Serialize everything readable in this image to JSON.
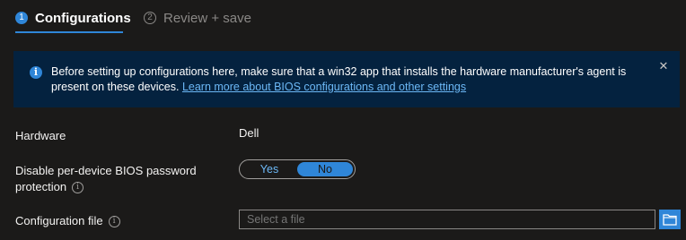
{
  "tabs": [
    {
      "number": "1",
      "label": "Configurations"
    },
    {
      "number": "2",
      "label": "Review + save"
    }
  ],
  "banner": {
    "message": "Before setting up configurations here, make sure that a win32 app that installs the hardware manufacturer's agent is present on these devices.",
    "link_text": "Learn more about BIOS configurations and other settings",
    "close_icon": "close-icon"
  },
  "hardware": {
    "label": "Hardware",
    "value": "Dell"
  },
  "bios_password": {
    "label": "Disable per-device BIOS password protection",
    "options": [
      "Yes",
      "No"
    ],
    "selected": "No"
  },
  "config_file": {
    "label": "Configuration file",
    "placeholder": "Select a file"
  },
  "colors": {
    "accent": "#2f86d8",
    "banner_bg": "#04223f",
    "page_bg": "#1b1a19",
    "link": "#6cb8f6"
  }
}
